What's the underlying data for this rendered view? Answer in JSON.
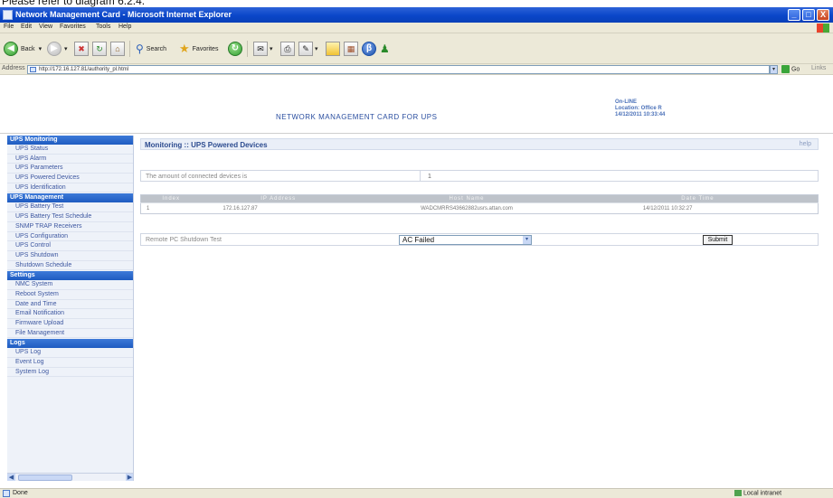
{
  "caption": "Please refer to diagram 6.2.4.",
  "window": {
    "title": "Network Management Card - Microsoft Internet Explorer",
    "minimize_glyph": "_",
    "maximize_glyph": "□",
    "close_glyph": "X"
  },
  "menu": [
    "File",
    "Edit",
    "View",
    "Favorites",
    "Tools",
    "Help"
  ],
  "toolbar": {
    "back_label": "Back",
    "search_label": "Search",
    "favorites_label": "Favorites"
  },
  "address": {
    "label": "Address",
    "url": "http://172.16.127.81/authority_pl.html",
    "go_label": "Go",
    "links_label": "Links"
  },
  "header": {
    "brand": "NETWORK MANAGEMENT CARD FOR UPS",
    "status": "On-LINE",
    "location": "Location: Office R",
    "datetime": "14/12/2011 10:33:44"
  },
  "sidebar": {
    "sections": [
      {
        "title": "UPS Monitoring",
        "items": [
          "UPS Status",
          "UPS Alarm",
          "UPS Parameters",
          "UPS Powered Devices",
          "UPS Identification"
        ]
      },
      {
        "title": "UPS Management",
        "items": [
          "UPS Battery Test",
          "UPS Battery Test Schedule",
          "SNMP TRAP Receivers",
          "UPS Configuration",
          "UPS Control",
          "UPS Shutdown",
          "Shutdown Schedule"
        ]
      },
      {
        "title": "Settings",
        "items": [
          "NMC System",
          "Reboot System",
          "Date and Time",
          "Email Notification",
          "Firmware Upload",
          "File Management"
        ]
      },
      {
        "title": "Logs",
        "items": [
          "UPS Log",
          "Event Log",
          "System Log"
        ]
      }
    ]
  },
  "main": {
    "breadcrumb": "Monitoring :: UPS Powered Devices",
    "help": "help",
    "count_label": "The amount of connected devices is",
    "count_value": "1",
    "table": {
      "headers": [
        "Index",
        "IP Address",
        "Host Name",
        "Date Time"
      ],
      "rows": [
        [
          "1",
          "172.16.127.87",
          "WADCMRRS43662882usrs.attan.com",
          "14/12/2011 10:32:27"
        ]
      ]
    },
    "shutdown_label": "Remote PC Shutdown Test",
    "shutdown_option": "AC Failed",
    "submit_label": "Submit"
  },
  "status": {
    "left": "Done",
    "right": "Local intranet"
  }
}
